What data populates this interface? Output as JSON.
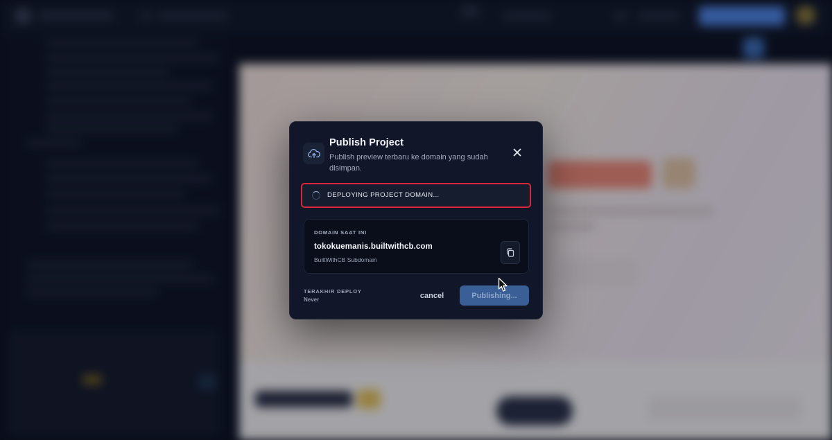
{
  "colors": {
    "modal_bg": "#111728",
    "highlight_border": "#d8283a",
    "primary_button": "#3a5f97",
    "domain_card_bg": "#0a0e1a"
  },
  "modal": {
    "icon": "cloud-upload-icon",
    "title": "Publish Project",
    "subtitle": "Publish preview terbaru ke domain yang sudah disimpan.",
    "close_icon": "close-icon",
    "status": {
      "icon": "loading-spinner-icon",
      "text": "DEPLOYING PROJECT DOMAIN..."
    },
    "domain": {
      "label": "DOMAIN SAAT INI",
      "value": "tokokuemanis.builtwithcb.com",
      "type": "BuiltWithCB Subdomain",
      "copy_icon": "copy-icon"
    },
    "last_deploy": {
      "label": "TERAKHIR DEPLOY",
      "value": "Never"
    },
    "cancel_label": "cancel",
    "publish_label": "Publishing..."
  }
}
